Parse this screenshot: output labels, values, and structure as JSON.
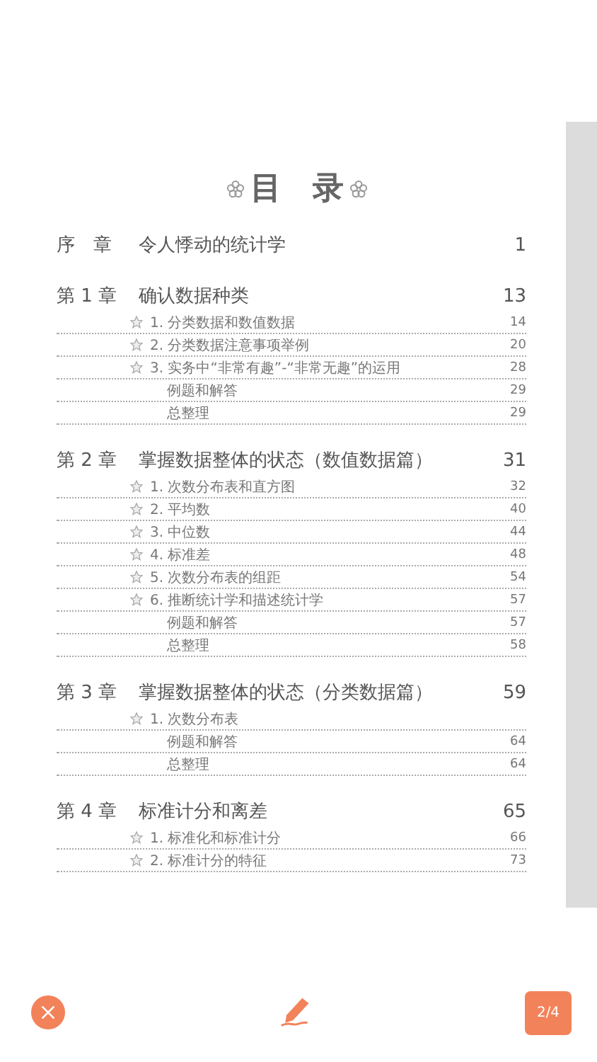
{
  "page": {
    "title": "目　录",
    "chapters": [
      {
        "label": "序　章",
        "title": "令人悸动的统计学",
        "page": "1"
      },
      {
        "label": "第 1 章",
        "title": "确认数据种类",
        "page": "13",
        "items": [
          {
            "kind": "section",
            "text": "1. 分类数据和数值数据",
            "page": "14"
          },
          {
            "kind": "section",
            "text": "2. 分类数据注意事项举例",
            "page": "20"
          },
          {
            "kind": "section",
            "text": "3. 实务中“非常有趣”-“非常无趣”的运用",
            "page": "28"
          },
          {
            "kind": "sub",
            "text": "例题和解答",
            "page": "29"
          },
          {
            "kind": "sub",
            "text": "总整理",
            "page": "29"
          }
        ]
      },
      {
        "label": "第 2 章",
        "title": "掌握数据整体的状态（数值数据篇）",
        "page": "31",
        "items": [
          {
            "kind": "section",
            "text": "1. 次数分布表和直方图",
            "page": "32"
          },
          {
            "kind": "section",
            "text": "2. 平均数",
            "page": "40"
          },
          {
            "kind": "section",
            "text": "3. 中位数",
            "page": "44"
          },
          {
            "kind": "section",
            "text": "4. 标准差",
            "page": "48"
          },
          {
            "kind": "section",
            "text": "5. 次数分布表的组距",
            "page": "54"
          },
          {
            "kind": "section",
            "text": "6. 推断统计学和描述统计学",
            "page": "57"
          },
          {
            "kind": "sub",
            "text": "例题和解答",
            "page": "57"
          },
          {
            "kind": "sub",
            "text": "总整理",
            "page": "58"
          }
        ]
      },
      {
        "label": "第 3 章",
        "title": "掌握数据整体的状态（分类数据篇）",
        "page": "59",
        "items": [
          {
            "kind": "section",
            "text": "1. 次数分布表"
          },
          {
            "kind": "sub",
            "text": "例题和解答",
            "page": "64"
          },
          {
            "kind": "sub",
            "text": "总整理",
            "page": "64"
          }
        ]
      },
      {
        "label": "第 4 章",
        "title": "标准计分和离差",
        "page": "65",
        "items": [
          {
            "kind": "section",
            "text": "1. 标准化和标准计分",
            "page": "66"
          },
          {
            "kind": "section",
            "text": "2. 标准计分的特征",
            "page": "73"
          }
        ]
      }
    ]
  },
  "toolbar": {
    "page_indicator": "2/4"
  }
}
